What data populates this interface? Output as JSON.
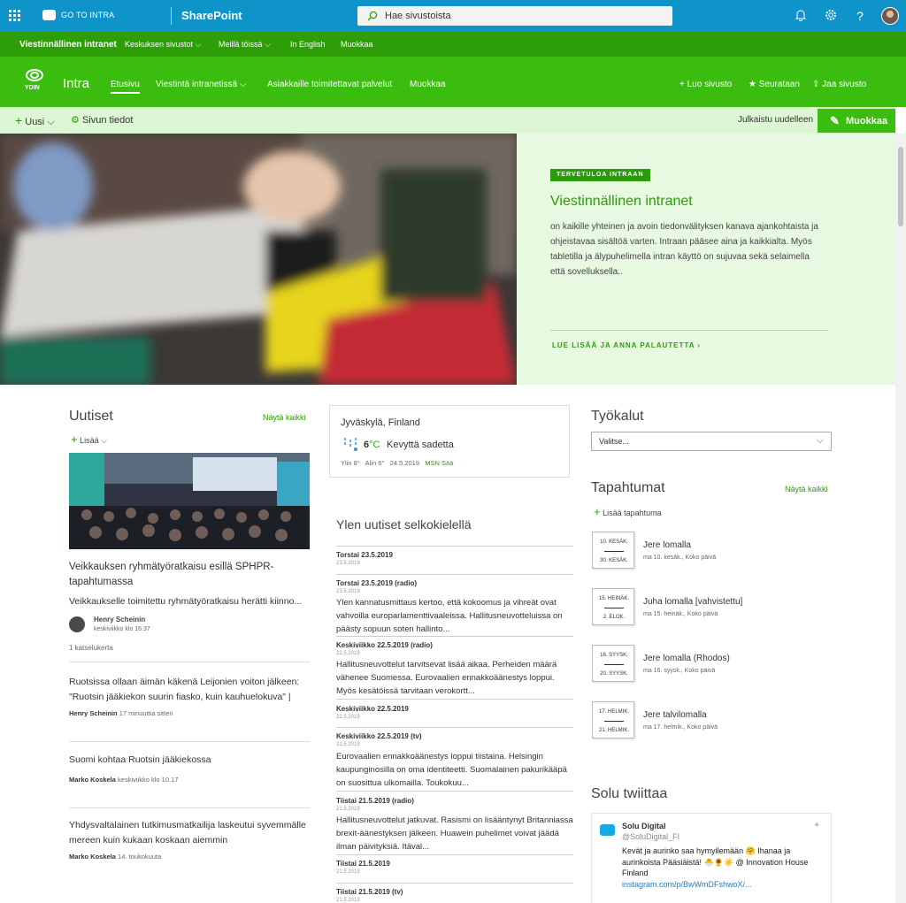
{
  "suite": {
    "go_to": "GO TO INTRA",
    "app": "SharePoint",
    "search_placeholder": "Hae sivustoista"
  },
  "hub": {
    "title": "Viestinnällinen intranet",
    "items": [
      "Keskuksen sivustot",
      "Meillä töissä",
      "In English",
      "Muokkaa"
    ]
  },
  "site": {
    "logo_text": "YDIN",
    "name": "Intra",
    "nav": [
      "Etusivu",
      "Viestintä intranetissä",
      "Asiakkaille toimitettavat palvelut",
      "Muokkaa"
    ],
    "actions": [
      "Luo sivusto",
      "Seurataan",
      "Jaa sivusto"
    ]
  },
  "command": {
    "new": "Uusi",
    "page_details": "Sivun tiedot",
    "republished": "Julkaistu uudelleen",
    "edit": "Muokkaa"
  },
  "hero": {
    "tag": "TERVETULOA INTRAAN",
    "title": "Viestinnällinen intranet",
    "body": "on kaikille yhteinen ja avoin tiedonvälityksen kanava ajankohtaista ja ohjeistavaa sisältöä varten. Intraan pääsee aina ja kaikkialta. Myös tabletilla ja älypuhelimella intran käyttö on sujuvaa sekä selaimella että sovelluksella..",
    "link": "LUE LISÄÄ JA ANNA PALAUTETTA"
  },
  "news": {
    "title": "Uutiset",
    "see_all": "Näytä kaikki",
    "add": "Lisää",
    "featured": {
      "title": "Veikkauksen ryhmätyöratkaisu esillä SPHPR-tapahtumassa",
      "excerpt": "Veikkaukselle toimitettu ryhmätyöratkaisu herätti kiinno...",
      "author": "Henry Scheinin",
      "date": "keskiviikko klo 16.37",
      "views": "1 katselukerta"
    },
    "items": [
      {
        "title": "Ruotsissa ollaan äimän käkenä Leijonien voiton jälkeen: \"Ruotsin jääkiekon suurin fiasko, kuin kauhuelokuva\" |",
        "author": "Henry Scheinin",
        "date": "17 minuuttia sitten"
      },
      {
        "title": "Suomi kohtaa Ruotsin jääkiekossa",
        "author": "Marko Koskela",
        "date": "keskiviikko klo 10.17"
      },
      {
        "title": "Yhdysvaltalainen tutkimusmatkailija laskeutui syvemmälle mereen kuin kukaan koskaan aiemmin",
        "author": "Marko Koskela",
        "date": "14. toukokuuta"
      }
    ]
  },
  "weather": {
    "location": "Jyväskylä, Finland",
    "temp": "6",
    "unit": "°C",
    "condition": "Kevyttä sadetta",
    "high": "Ylin 8°",
    "low": "Alin 6°",
    "date": "24.5.2019",
    "source": "MSN Sää"
  },
  "yle": {
    "title": "Ylen uutiset selkokielellä",
    "items": [
      {
        "h": "Torstai 23.5.2019",
        "d": "23.5.2019",
        "t": ""
      },
      {
        "h": "Torstai 23.5.2019 (radio)",
        "d": "23.5.2019",
        "t": "Ylen kannatusmittaus kertoo, että kokoomus ja vihreät ovat vahvoilla europarlamenttivaaleissa. Hallitusneuvotteluissa on päästy sopuun soten hallinto..."
      },
      {
        "h": "Keskiviikko 22.5.2019 (radio)",
        "d": "22.5.2019",
        "t": "Hallitusneuvottelut tarvitsevat lisää aikaa. Perheiden määrä vähenee Suomessa. Eurovaalien ennakkoäänestys loppui. Myös kesätöissä tarvitaan verokortt..."
      },
      {
        "h": "Keskiviikko 22.5.2019",
        "d": "22.5.2019",
        "t": ""
      },
      {
        "h": "Keskiviikko 22.5.2019 (tv)",
        "d": "22.5.2019",
        "t": "Eurovaalien ennakkoäänestys loppui tiistaina. Helsingin kaupunginosilla on oma identiteetti. Suomalainen pakurikääpä on suosittua ulkomailla. Toukokuu..."
      },
      {
        "h": "Tiistai 21.5.2019 (radio)",
        "d": "21.5.2019",
        "t": "Hallitusneuvottelut jatkuvat. Rasismi on lisääntynyt Britanniassa brexit-äänestyksen jälkeen. Huawein puhelimet voivat jäädä ilman päivityksiä. Itäval..."
      },
      {
        "h": "Tiistai 21.5.2019",
        "d": "21.5.2019",
        "t": ""
      },
      {
        "h": "Tiistai 21.5.2019 (tv)",
        "d": "21.5.2019",
        "t": ""
      }
    ]
  },
  "tools": {
    "title": "Työkalut",
    "select": "Valitse..."
  },
  "events": {
    "title": "Tapahtumat",
    "see_all": "Näytä kaikki",
    "add": "Lisää tapahtuma",
    "items": [
      {
        "start": "10. KESÄK.",
        "end": "30. KESÄK.",
        "title": "Jere lomalla",
        "detail": "ma 10. kesäk., Koko päivä"
      },
      {
        "start": "15. HEINÄK.",
        "end": "2. ELOK.",
        "title": "Juha lomalla [vahvistettu]",
        "detail": "ma 15. heinäk., Koko päivä"
      },
      {
        "start": "16. SYYSK.",
        "end": "20. SYYSK.",
        "title": "Jere lomalla (Rhodos)",
        "detail": "ma 16. syysk., Koko päivä"
      },
      {
        "start": "17. HELMIK.",
        "end": "21. HELMIK.",
        "title": "Jere talvilomalla",
        "detail": "ma 17. helmik., Koko päivä"
      }
    ]
  },
  "tweets": {
    "title": "Solu twiittaa",
    "name": "Solu Digital",
    "handle": "@SoluDigital_FI",
    "text": "Kevät ja aurinko saa hymyilemään 🤗 Ihanaa ja aurinkoista Pääsiäistä! 🐣🌻☀️ @ Innovation House Finland",
    "link": "instagram.com/p/BwWmDFshwoX/..."
  }
}
